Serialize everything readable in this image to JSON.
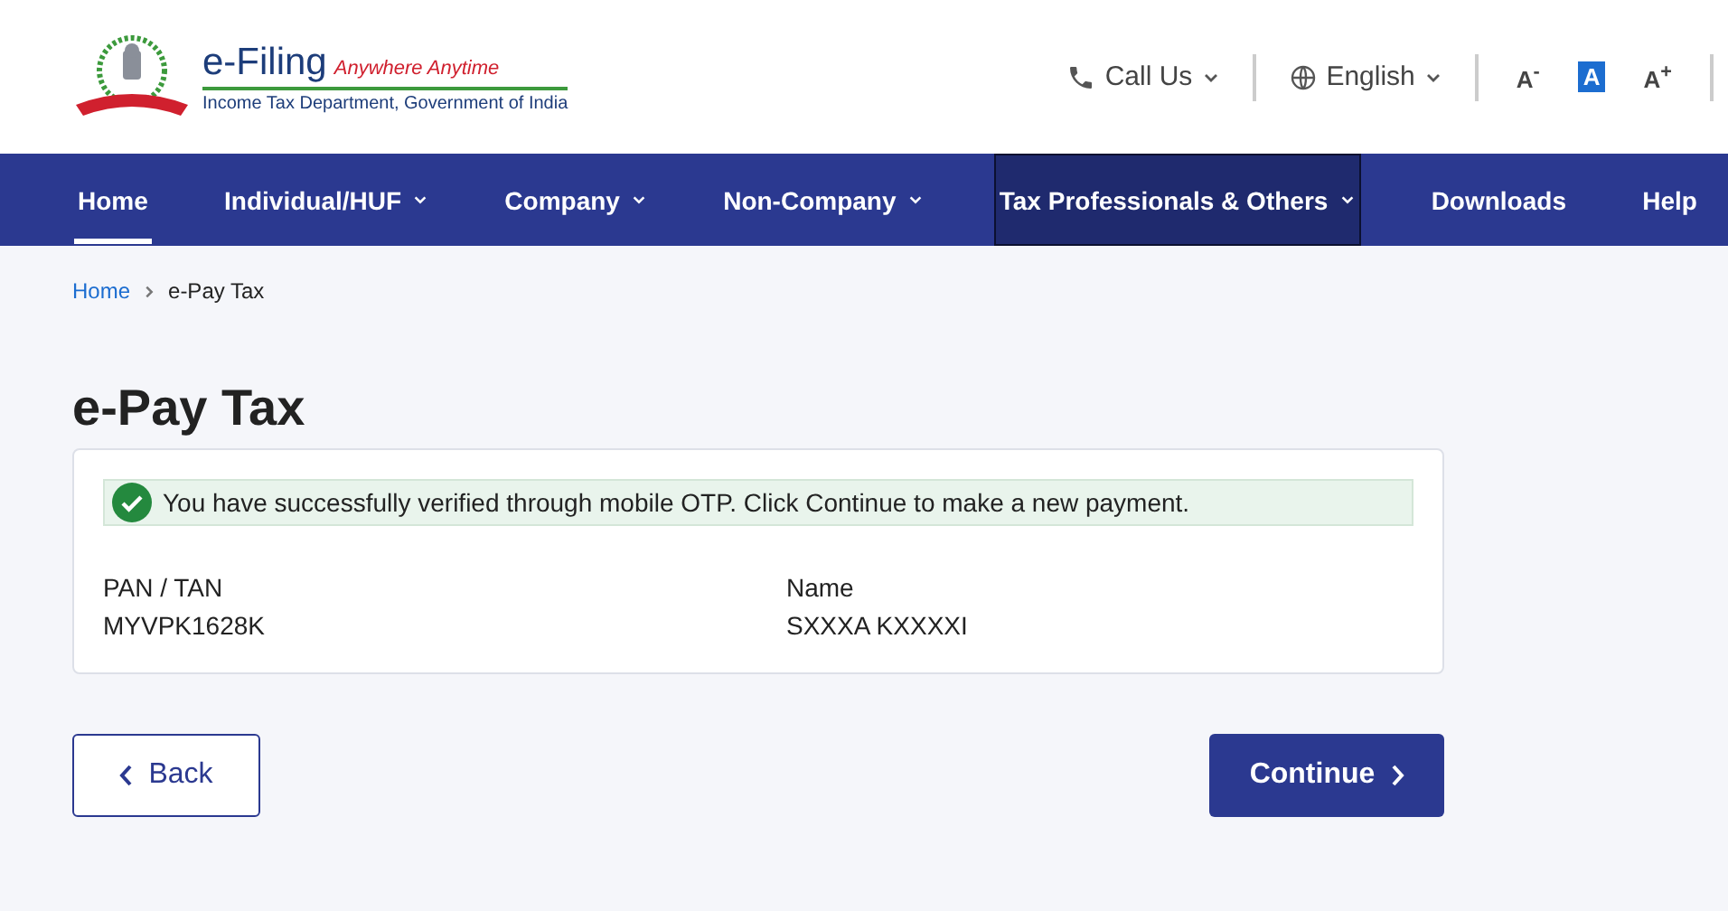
{
  "logo": {
    "title": "e-Filing",
    "tagline": "Anywhere Anytime",
    "subtitle": "Income Tax Department, Government of India"
  },
  "utility": {
    "call": "Call Us",
    "language": "English",
    "font_sizes": [
      {
        "label": "A$^{-}$",
        "selected": false
      },
      {
        "label": "A",
        "selected": true
      },
      {
        "label": "A$^{+}$",
        "selected": false
      }
    ]
  },
  "nav": [
    {
      "label": "Home",
      "dropdown": false,
      "selected": true,
      "focused": false
    },
    {
      "label": "Individual/HUF",
      "dropdown": true,
      "selected": false,
      "focused": false
    },
    {
      "label": "Company",
      "dropdown": true,
      "selected": false,
      "focused": false
    },
    {
      "label": "Non-Company",
      "dropdown": true,
      "selected": false,
      "focused": false
    },
    {
      "label": "Tax Professionals & Others",
      "dropdown": true,
      "selected": false,
      "focused": true
    },
    {
      "label": "Downloads",
      "dropdown": false,
      "selected": false,
      "focused": false
    },
    {
      "label": "Help",
      "dropdown": false,
      "selected": false,
      "focused": false
    }
  ],
  "breadcrumb": [
    "Home",
    "e-Pay Tax"
  ],
  "title": "e-Pay Tax",
  "alert": "You have successfully verified through mobile OTP. Click Continue to make a new payment.",
  "fields": [
    {
      "label": "PAN / TAN",
      "value": "MYVPK1628K"
    },
    {
      "label": "Name",
      "value": "SXXXA KXXXXI"
    }
  ],
  "buttons": {
    "back": "Back",
    "continue": "Continue"
  }
}
